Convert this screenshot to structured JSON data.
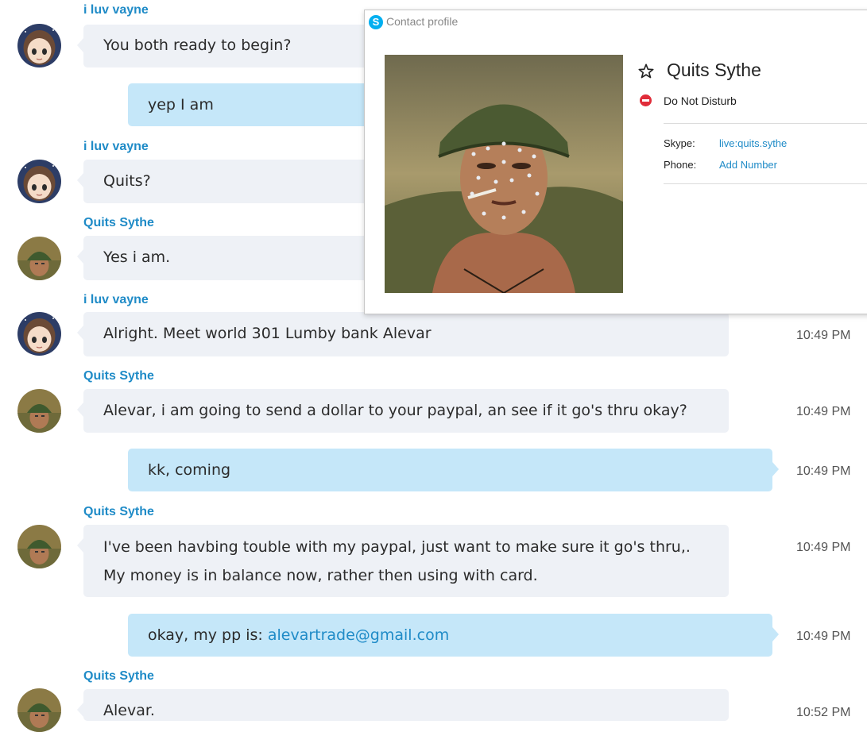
{
  "messages": [
    {
      "sender": "i luv vayne",
      "lines": [
        "You both ready to begin?"
      ]
    },
    {
      "lines": [
        "yep I am"
      ]
    },
    {
      "sender": "i luv vayne",
      "lines": [
        "Quits?"
      ]
    },
    {
      "sender": "Quits Sythe",
      "lines": [
        "Yes i am."
      ]
    },
    {
      "sender": "i luv vayne",
      "lines": [
        "Alright. Meet world 301 Lumby bank Alevar"
      ],
      "time": "10:49 PM"
    },
    {
      "sender": "Quits Sythe",
      "lines": [
        "Alevar, i am going to send a dollar to your paypal, an see if it go's thru okay?"
      ],
      "time": "10:49 PM"
    },
    {
      "lines": [
        "kk, coming"
      ],
      "time": "10:49 PM"
    },
    {
      "sender": "Quits Sythe",
      "lines": [
        "I've been havbing touble with my paypal, just want to make sure it go's thru,.",
        "My money is in balance now, rather then using with card."
      ],
      "time": "10:49 PM"
    },
    {
      "prefix": "okay, my pp is: ",
      "link": "alevartrade@gmail.com",
      "time": "10:49 PM"
    },
    {
      "sender": "Quits Sythe",
      "lines": [
        "Alevar."
      ],
      "time": "10:52 PM"
    }
  ],
  "profile": {
    "title": "Contact profile",
    "name": "Quits Sythe",
    "status": "Do Not Disturb",
    "skype_label": "Skype:",
    "skype_value": "live:quits.sythe",
    "phone_label": "Phone:",
    "phone_value": "Add Number"
  },
  "colors": {
    "link": "#1f8bc7",
    "incoming_bubble": "#eef1f6",
    "outgoing_bubble": "#c5e7f9",
    "dnd": "#e02d3a"
  }
}
